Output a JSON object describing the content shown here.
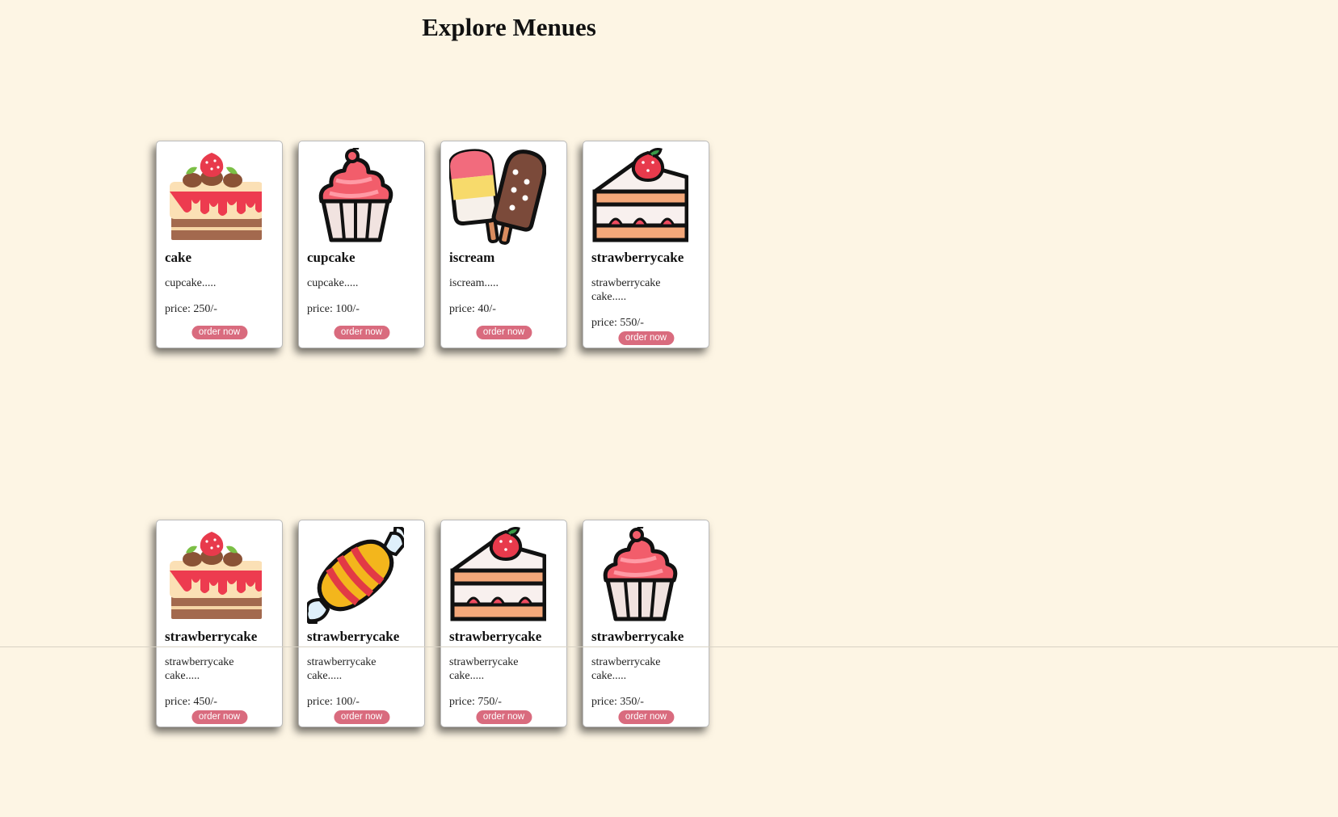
{
  "page": {
    "title": "Explore Menues"
  },
  "colors": {
    "background": "#fdf5e4",
    "button": "#d96b7e",
    "card": "#ffffff"
  },
  "menu": [
    {
      "name": "cake",
      "desc": "cupcake.....",
      "price": "price: 250/-",
      "button": "order now",
      "icon": "layer-cake-icon"
    },
    {
      "name": "cupcake",
      "desc": "cupcake.....",
      "price": "price: 100/-",
      "button": "order now",
      "icon": "cupcake-icon"
    },
    {
      "name": "iscream",
      "desc": "iscream.....",
      "price": "price: 40/-",
      "button": "order now",
      "icon": "ice-cream-bars-icon"
    },
    {
      "name": "strawberrycake",
      "desc": "strawberrycake cake.....",
      "price": "price: 550/-",
      "button": "order now",
      "icon": "cake-slice-icon"
    },
    {
      "name": "strawberrycake",
      "desc": "strawberrycake cake.....",
      "price": "price: 450/-",
      "button": "order now",
      "icon": "layer-cake-icon"
    },
    {
      "name": "strawberrycake",
      "desc": "strawberrycake cake.....",
      "price": "price: 100/-",
      "button": "order now",
      "icon": "candy-icon"
    },
    {
      "name": "strawberrycake",
      "desc": "strawberrycake cake.....",
      "price": "price: 750/-",
      "button": "order now",
      "icon": "cake-slice-icon"
    },
    {
      "name": "strawberrycake",
      "desc": "strawberrycake cake.....",
      "price": "price: 350/-",
      "button": "order now",
      "icon": "cupcake-icon"
    }
  ]
}
